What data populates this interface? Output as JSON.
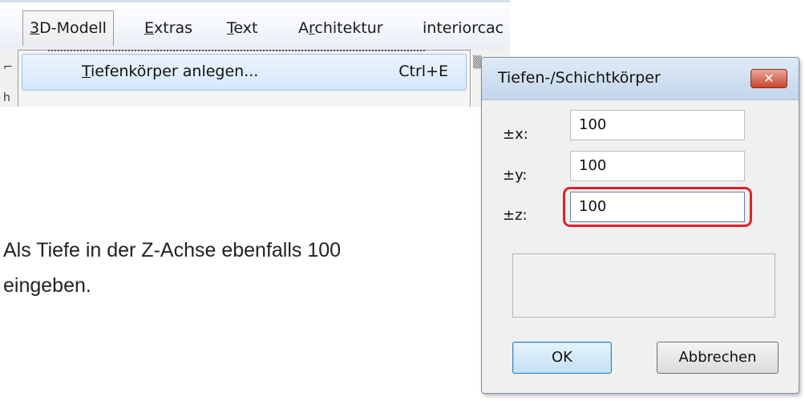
{
  "menubar": {
    "items": [
      {
        "pre": "",
        "mnemonic": "3",
        "post": "D-Modell"
      },
      {
        "pre": "",
        "mnemonic": "E",
        "post": "xtras"
      },
      {
        "pre": "",
        "mnemonic": "T",
        "post": "ext"
      },
      {
        "pre": "A",
        "mnemonic": "r",
        "post": "chitektur"
      },
      {
        "pre": "",
        "mnemonic": "",
        "post": "interiorcac"
      }
    ]
  },
  "dropdown": {
    "item": {
      "mnemonic": "T",
      "label_rest": "iefenkörper anlegen...",
      "shortcut": "Ctrl+E"
    }
  },
  "instruction": {
    "line1": "Als Tiefe in der Z-Achse ebenfalls 100",
    "line2": "eingeben."
  },
  "dialog": {
    "title": "Tiefen-/Schichtkörper",
    "close_glyph": "✕",
    "fields": [
      {
        "label": "±x:",
        "value": "100"
      },
      {
        "label": "±y:",
        "value": "100"
      },
      {
        "label": "±z:",
        "value": "100"
      }
    ],
    "ok_label": "OK",
    "cancel_label": "Abbrechen"
  },
  "colors": {
    "highlight_ring": "#e0202a",
    "menu_hover": "#d7e8fb",
    "close_button": "#c9452f"
  }
}
